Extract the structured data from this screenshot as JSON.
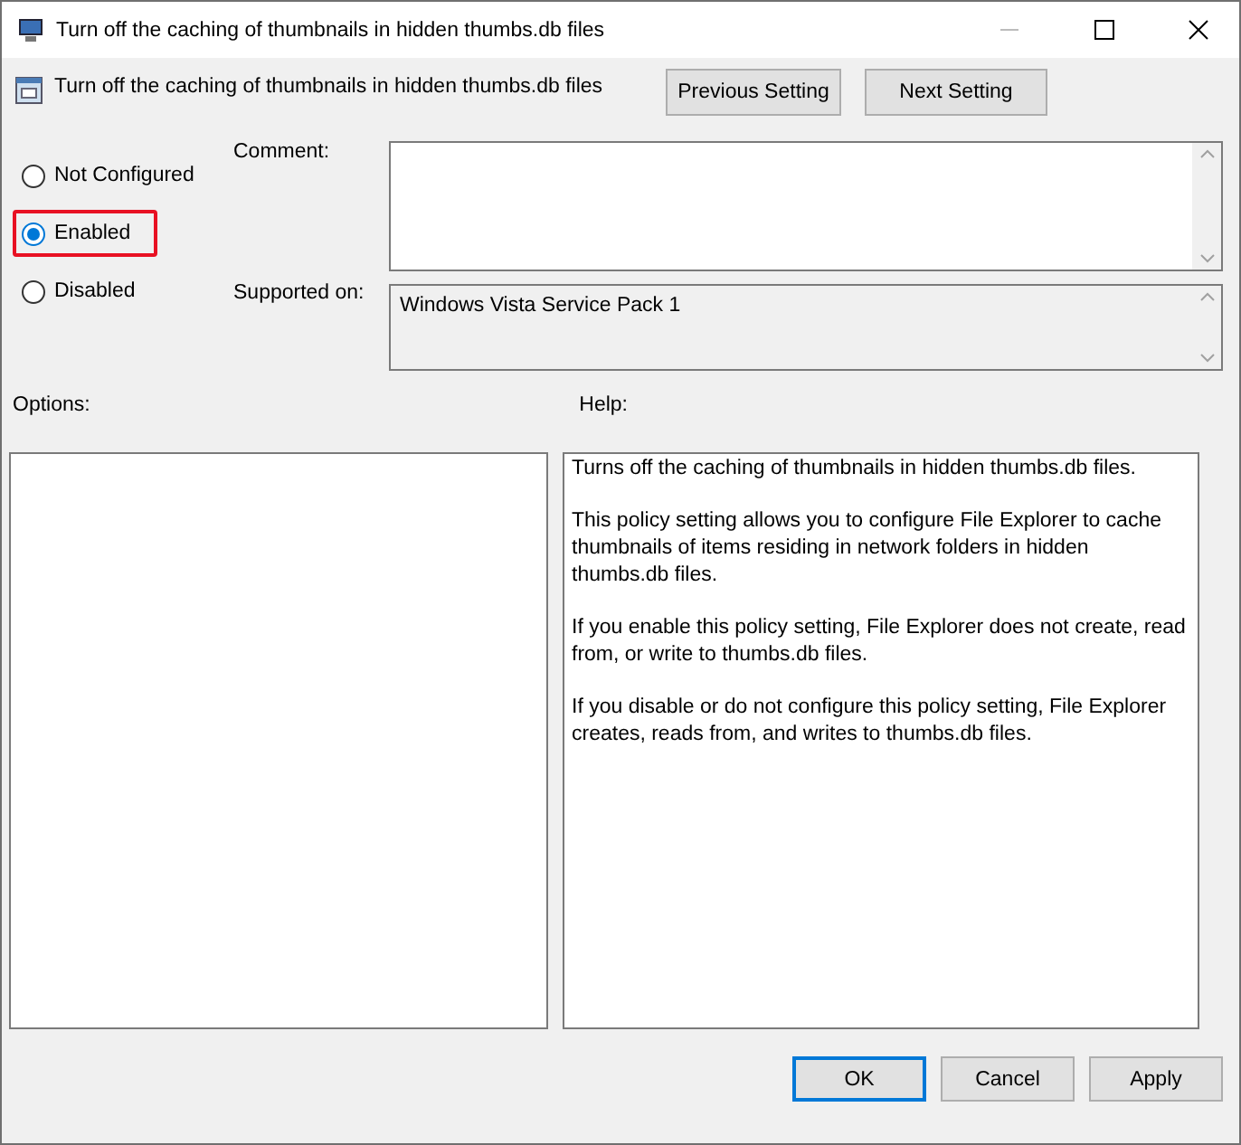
{
  "window": {
    "title": "Turn off the caching of thumbnails in hidden thumbs.db files"
  },
  "header": {
    "title": "Turn off the caching of thumbnails in hidden thumbs.db files",
    "buttons": [
      "Previous Setting",
      "Next Setting"
    ]
  },
  "state_options": [
    {
      "label": "Not Configured",
      "selected": false,
      "highlighted": false
    },
    {
      "label": "Enabled",
      "selected": true,
      "highlighted": true
    },
    {
      "label": "Disabled",
      "selected": false,
      "highlighted": false
    }
  ],
  "comment": {
    "label": "Comment:"
  },
  "supported_on": {
    "label": "Supported on:",
    "value": "Windows Vista Service Pack 1"
  },
  "options": {
    "label": "Options:"
  },
  "help": {
    "label": "Help:",
    "paragraphs": [
      "Turns off the caching of thumbnails in hidden thumbs.db files.",
      "This policy setting allows you to configure File Explorer to cache thumbnails of items residing in network folders in hidden thumbs.db files.",
      "If you enable this policy setting, File Explorer does not create, read from, or write to thumbs.db files.",
      "If you disable or do not configure this policy setting, File Explorer creates, reads from, and writes to thumbs.db files."
    ]
  },
  "footer_buttons": [
    {
      "label": "OK",
      "default": true
    },
    {
      "label": "Cancel",
      "default": false
    },
    {
      "label": "Apply",
      "default": false
    }
  ]
}
